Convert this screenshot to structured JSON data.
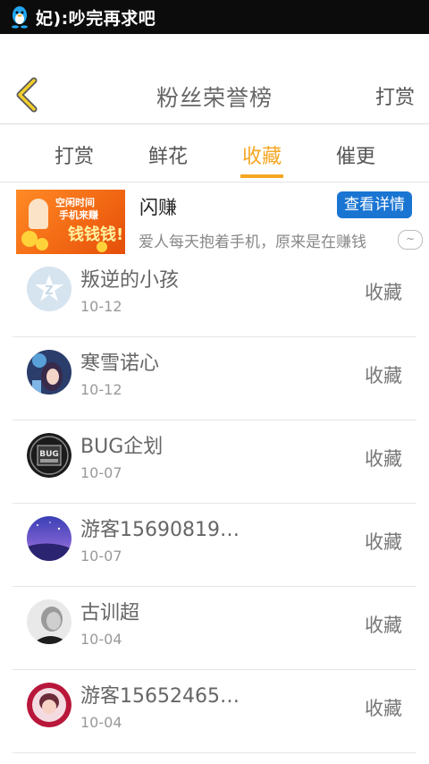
{
  "status_bar": {
    "notification_text": "妃):吵完再求吧"
  },
  "header": {
    "title": "粉丝荣誉榜",
    "right_action": "打赏"
  },
  "tabs": [
    {
      "label": "打赏",
      "active": false
    },
    {
      "label": "鲜花",
      "active": false
    },
    {
      "label": "收藏",
      "active": true
    },
    {
      "label": "催更",
      "active": false
    }
  ],
  "ad": {
    "image_lines": [
      "空闲时间",
      "手机来赚",
      "钱钱钱!"
    ],
    "title": "闪赚",
    "description": "爱人每天抱着手机，原来是在赚钱",
    "button_label": "查看详情",
    "close_label": "~"
  },
  "fans": [
    {
      "name": "叛逆的小孩",
      "date": "10-12",
      "action": "收藏",
      "avatar": "default-avatar"
    },
    {
      "name": "寒雪诺心",
      "date": "10-12",
      "action": "收藏",
      "avatar": "anime-girl-avatar"
    },
    {
      "name": "BUG企划",
      "date": "10-07",
      "action": "收藏",
      "avatar": "bug-logo-avatar"
    },
    {
      "name": "游客15690819…",
      "date": "10-07",
      "action": "收藏",
      "avatar": "galaxy-avatar"
    },
    {
      "name": "古训超",
      "date": "10-04",
      "action": "收藏",
      "avatar": "portrait-avatar"
    },
    {
      "name": "游客15652465…",
      "date": "10-04",
      "action": "收藏",
      "avatar": "pink-avatar"
    }
  ],
  "colors": {
    "accent": "#f5a623",
    "ad_button": "#1a75d2",
    "status_bar": "#0c0c0c"
  }
}
